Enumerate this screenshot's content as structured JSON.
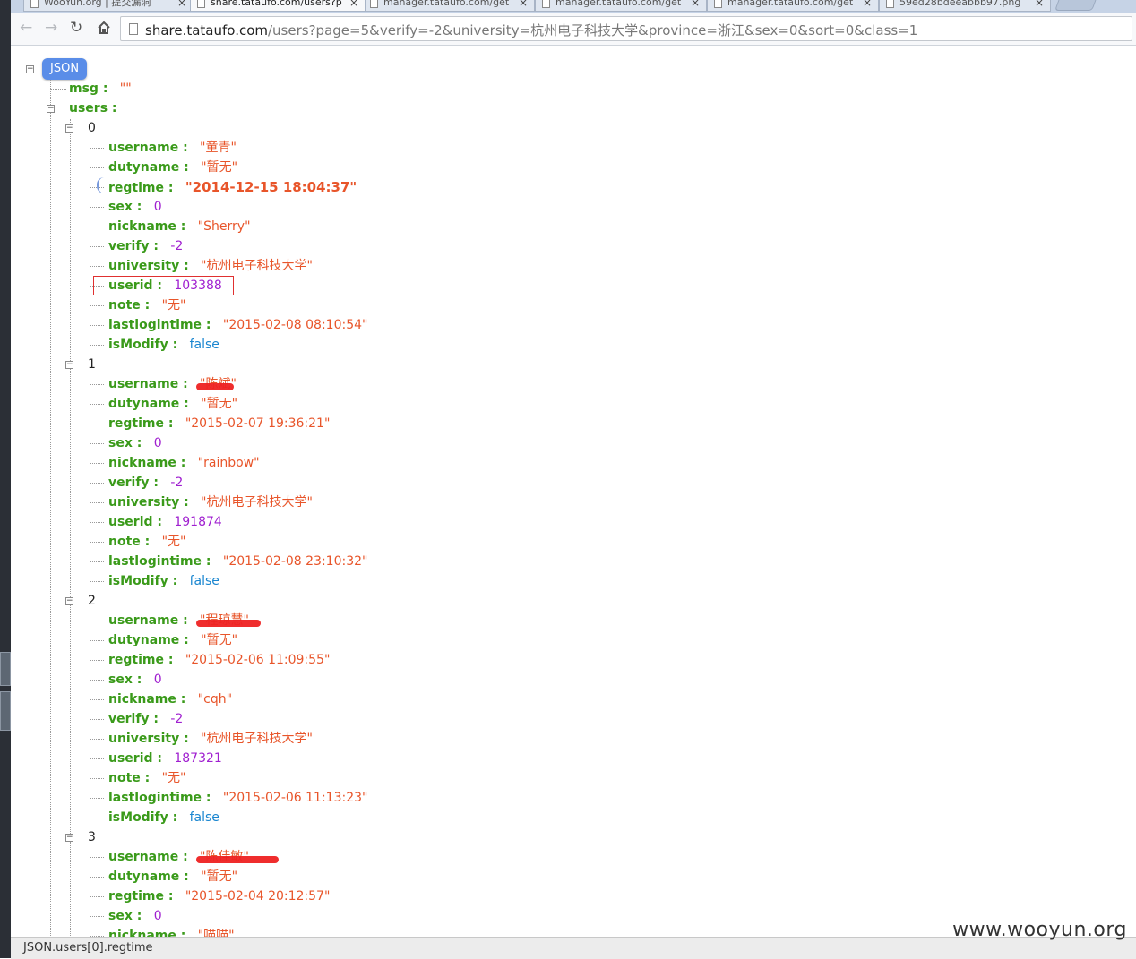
{
  "tabs": [
    {
      "title": "WooYun.org | 提交漏洞",
      "active": false
    },
    {
      "title": "share.tataufo.com/users?p",
      "active": true
    },
    {
      "title": "manager.tataufo.com/get",
      "active": false
    },
    {
      "title": "manager.tataufo.com/get",
      "active": false
    },
    {
      "title": "manager.tataufo.com/get",
      "active": false
    },
    {
      "title": "59ed28bdeeabbb97.png",
      "active": false
    }
  ],
  "address_bar": {
    "host": "share.tataufo.com",
    "path": "/users?page=5&verify=-2&university=杭州电子科技大学&province=浙江&sex=0&sort=0&class=1"
  },
  "json": {
    "root_label": "JSON",
    "msg_key": "msg :",
    "msg_value": "\"\"",
    "users_key": "users :",
    "users": [
      {
        "index": "0",
        "fields": [
          {
            "key": "username :",
            "value": "\"童青\"",
            "type": "str"
          },
          {
            "key": "dutyname :",
            "value": "\"暂无\"",
            "type": "str"
          },
          {
            "key": "regtime :",
            "value": "\"2014-12-15 18:04:37\"",
            "type": "str",
            "bold": true
          },
          {
            "key": "sex :",
            "value": "0",
            "type": "num"
          },
          {
            "key": "nickname :",
            "value": "\"Sherry\"",
            "type": "str"
          },
          {
            "key": "verify :",
            "value": "-2",
            "type": "num"
          },
          {
            "key": "university :",
            "value": "\"杭州电子科技大学\"",
            "type": "str"
          },
          {
            "key": "userid :",
            "value": "103388",
            "type": "num",
            "highlight": true
          },
          {
            "key": "note :",
            "value": "\"无\"",
            "type": "str"
          },
          {
            "key": "lastlogintime :",
            "value": "\"2015-02-08 08:10:54\"",
            "type": "str"
          },
          {
            "key": "isModify :",
            "value": "false",
            "type": "bool"
          }
        ]
      },
      {
        "index": "1",
        "fields": [
          {
            "key": "username :",
            "value": "\"陈斌\"",
            "type": "str",
            "redacted": true
          },
          {
            "key": "dutyname :",
            "value": "\"暂无\"",
            "type": "str"
          },
          {
            "key": "regtime :",
            "value": "\"2015-02-07 19:36:21\"",
            "type": "str"
          },
          {
            "key": "sex :",
            "value": "0",
            "type": "num"
          },
          {
            "key": "nickname :",
            "value": "\"rainbow\"",
            "type": "str"
          },
          {
            "key": "verify :",
            "value": "-2",
            "type": "num"
          },
          {
            "key": "university :",
            "value": "\"杭州电子科技大学\"",
            "type": "str"
          },
          {
            "key": "userid :",
            "value": "191874",
            "type": "num"
          },
          {
            "key": "note :",
            "value": "\"无\"",
            "type": "str"
          },
          {
            "key": "lastlogintime :",
            "value": "\"2015-02-08 23:10:32\"",
            "type": "str"
          },
          {
            "key": "isModify :",
            "value": "false",
            "type": "bool"
          }
        ]
      },
      {
        "index": "2",
        "fields": [
          {
            "key": "username :",
            "value": "\"程琼慧\"",
            "type": "str",
            "redacted": true
          },
          {
            "key": "dutyname :",
            "value": "\"暂无\"",
            "type": "str"
          },
          {
            "key": "regtime :",
            "value": "\"2015-02-06 11:09:55\"",
            "type": "str"
          },
          {
            "key": "sex :",
            "value": "0",
            "type": "num"
          },
          {
            "key": "nickname :",
            "value": "\"cqh\"",
            "type": "str"
          },
          {
            "key": "verify :",
            "value": "-2",
            "type": "num"
          },
          {
            "key": "university :",
            "value": "\"杭州电子科技大学\"",
            "type": "str"
          },
          {
            "key": "userid :",
            "value": "187321",
            "type": "num"
          },
          {
            "key": "note :",
            "value": "\"无\"",
            "type": "str"
          },
          {
            "key": "lastlogintime :",
            "value": "\"2015-02-06 11:13:23\"",
            "type": "str"
          },
          {
            "key": "isModify :",
            "value": "false",
            "type": "bool"
          }
        ]
      },
      {
        "index": "3",
        "fields": [
          {
            "key": "username :",
            "value": "\"陈佳敏\"",
            "type": "str",
            "redacted": true
          },
          {
            "key": "dutyname :",
            "value": "\"暂无\"",
            "type": "str"
          },
          {
            "key": "regtime :",
            "value": "\"2015-02-04 20:12:57\"",
            "type": "str"
          },
          {
            "key": "sex :",
            "value": "0",
            "type": "num"
          },
          {
            "key": "nickname :",
            "value": "\"喵喵\"",
            "type": "str"
          }
        ]
      }
    ]
  },
  "status_bar": {
    "path": "JSON.users[0].regtime"
  },
  "watermark": "www.wooyun.org",
  "colors": {
    "key": "#3a9a1a",
    "string": "#e8552a",
    "number": "#a020d0",
    "boolean": "#1a86d0",
    "badge": "#5a8de8"
  },
  "icons": {
    "back": "arrow-left-icon",
    "forward": "arrow-right-icon",
    "reload": "reload-icon",
    "home": "home-icon"
  }
}
